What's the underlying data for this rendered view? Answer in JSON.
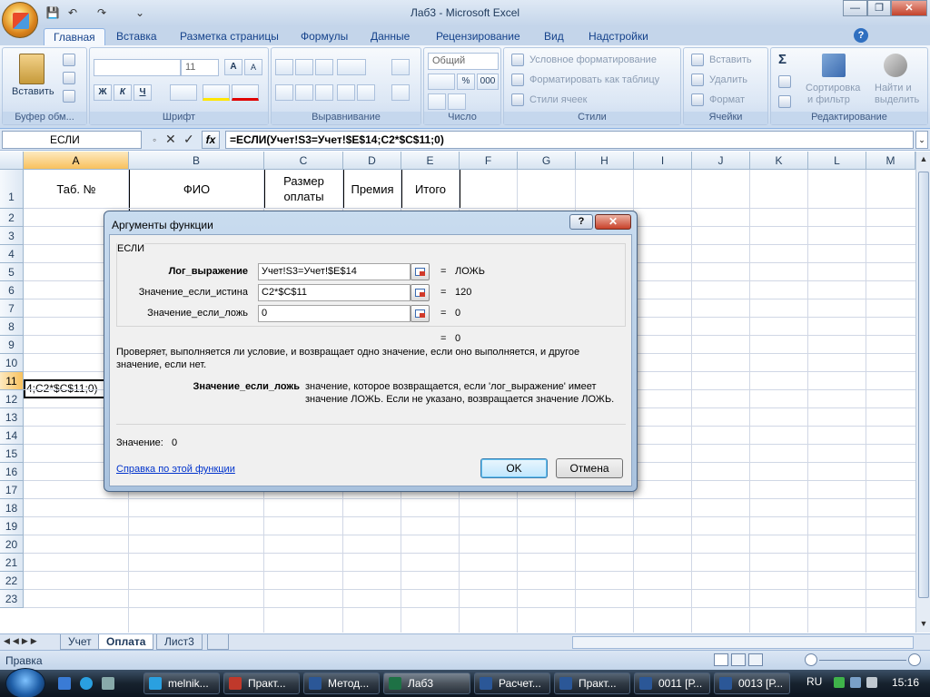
{
  "window": {
    "title": "Лаб3 - Microsoft Excel",
    "minimize": "—",
    "restore": "❐",
    "close": "✕"
  },
  "qat": {
    "save": "💾",
    "undo": "↶",
    "redo": "↷",
    "customize": "⌄"
  },
  "help_icon": "?",
  "tabs": [
    "Главная",
    "Вставка",
    "Разметка страницы",
    "Формулы",
    "Данные",
    "Рецензирование",
    "Вид",
    "Надстройки"
  ],
  "ribbon": {
    "clipboard": {
      "paste": "Вставить",
      "label": "Буфер обм..."
    },
    "font": {
      "size": "11",
      "bold": "Ж",
      "italic": "К",
      "underline": "Ч",
      "grow": "A",
      "shrink": "A",
      "label": "Шрифт"
    },
    "alignment": {
      "label": "Выравнивание"
    },
    "number": {
      "format": "Общий",
      "percent": "%",
      "thousands": "000",
      "label": "Число"
    },
    "styles": {
      "conditional": "Условное форматирование",
      "as_table": "Форматировать как таблицу",
      "cell_styles": "Стили ячеек",
      "label": "Стили"
    },
    "cells": {
      "insert": "Вставить",
      "delete": "Удалить",
      "format": "Формат",
      "label": "Ячейки"
    },
    "editing": {
      "sum": "Σ",
      "sort_line1": "Сортировка",
      "sort_line2": "и фильтр",
      "find_line1": "Найти и",
      "find_line2": "выделить",
      "label": "Редактирование"
    }
  },
  "formula_bar": {
    "name": "ЕСЛИ",
    "cancel": "✕",
    "enter": "✓",
    "fx": "fx",
    "formula": "=ЕСЛИ(Учет!S3=Учет!$E$14;C2*$C$11;0)"
  },
  "grid": {
    "columns": [
      "A",
      "B",
      "C",
      "D",
      "E",
      "F",
      "G",
      "H",
      "I",
      "J",
      "K",
      "L",
      "M"
    ],
    "rows": [
      "1",
      "2",
      "3",
      "4",
      "5",
      "6",
      "7",
      "8",
      "9",
      "10",
      "11",
      "12",
      "13",
      "14",
      "15",
      "16",
      "17",
      "18",
      "19",
      "20",
      "21",
      "22",
      "23"
    ],
    "header_cells": {
      "a1": "Таб. №",
      "b1": "ФИО",
      "c1": "Размер оплаты",
      "d1": "Премия",
      "e1": "Итого"
    },
    "a11": "4;C2*$C$11;0)"
  },
  "sheets": [
    "Учет",
    "Оплата",
    "Лист3"
  ],
  "status": {
    "mode": "Правка"
  },
  "dialog": {
    "title": "Аргументы функции",
    "help": "?",
    "close": "✕",
    "function": "ЕСЛИ",
    "args": [
      {
        "label": "Лог_выражение",
        "value": "Учет!S3=Учет!$E$14",
        "result": "ЛОЖЬ"
      },
      {
        "label": "Значение_если_истина",
        "value": "C2*$C$11",
        "result": "120"
      },
      {
        "label": "Значение_если_ложь",
        "value": "0",
        "result": "0"
      }
    ],
    "eq": "=",
    "total": "0",
    "description": "Проверяет, выполняется ли условие, и возвращает одно значение, если оно выполняется, и другое значение, если нет.",
    "arg_name": "Значение_если_ложь",
    "arg_desc": "значение, которое возвращается, если 'лог_выражение' имеет значение ЛОЖЬ. Если не указано, возвращается значение ЛОЖЬ.",
    "value_label": "Значение:",
    "value": "0",
    "help_link": "Справка по этой функции",
    "ok": "OK",
    "cancel": "Отмена"
  },
  "taskbar": {
    "items": [
      "melnik...",
      "Практ...",
      "Метод...",
      "Лаб3",
      "Расчет...",
      "Практ...",
      "0011 [Р...",
      "0013 [Р..."
    ],
    "lang": "RU",
    "time": "15:16"
  }
}
